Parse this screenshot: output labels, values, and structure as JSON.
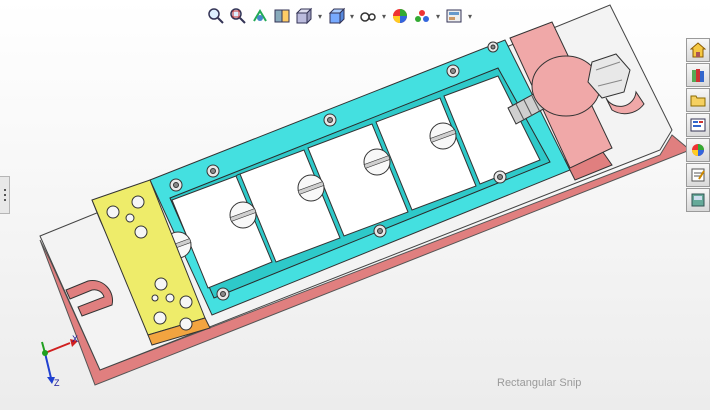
{
  "toolbar": {
    "tools": [
      {
        "name": "zoom-to-fit"
      },
      {
        "name": "zoom-to-area"
      },
      {
        "name": "previous-view"
      },
      {
        "name": "section-view"
      },
      {
        "name": "view-orientation",
        "dropdown": true
      },
      {
        "name": "display-style",
        "dropdown": true
      },
      {
        "name": "hide-show-items",
        "dropdown": true
      },
      {
        "name": "edit-appearance"
      },
      {
        "name": "apply-scene",
        "dropdown": true
      },
      {
        "name": "view-settings",
        "dropdown": true
      }
    ]
  },
  "task_pane": {
    "tabs": [
      "resources",
      "design-library",
      "file-explorer",
      "view-palette",
      "appearances",
      "custom-properties",
      "feature-manager"
    ]
  },
  "overlay": {
    "snip_label": "Rectangular Snip"
  },
  "triad": {
    "x_label": "X",
    "z_label": "Z"
  },
  "colors": {
    "base_plate": "#f2f2f2",
    "base_side": "#e07f7f",
    "rail": "#44e0e0",
    "end_block": "#f0a8a8",
    "yellow_block": "#eeec6a",
    "orange_strip": "#f2a440",
    "white_block": "#ffffff"
  }
}
